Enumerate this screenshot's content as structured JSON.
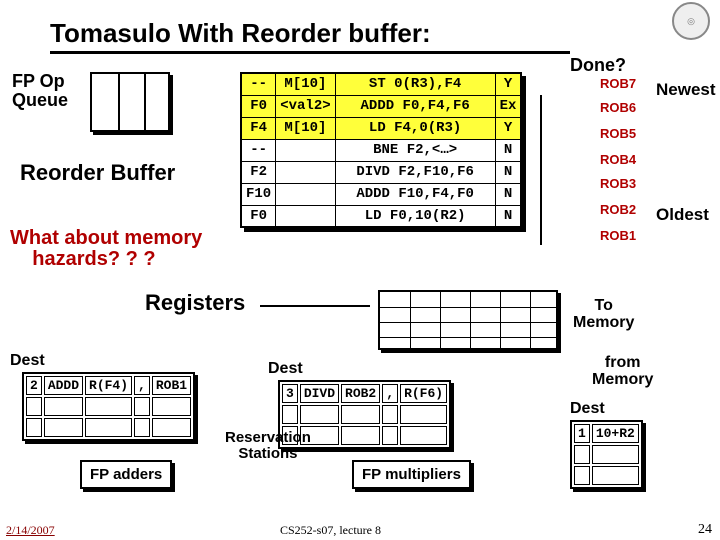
{
  "title": "Tomasulo With Reorder buffer:",
  "done_label": "Done?",
  "fp_op_queue": "FP Op\nQueue",
  "reorder_buffer_label": "Reorder Buffer",
  "what_about": "What about memory\n    hazards? ? ?",
  "registers_label": "Registers",
  "to_memory": "To\nMemory",
  "from_memory": "from\nMemory",
  "dest_label": "Dest",
  "rs_label": "Reservation\nStations",
  "fp_adders": "FP adders",
  "fp_multipliers": "FP multipliers",
  "newest": "Newest",
  "oldest": "Oldest",
  "footer_date": "2/14/2007",
  "footer_mid": "CS252-s07, lecture 8",
  "footer_num": "24",
  "rob": [
    {
      "d": "--",
      "v": "M[10]",
      "i": "ST 0(R3),F4",
      "s": "Y",
      "tag": "ROB7",
      "hl": true
    },
    {
      "d": "F0",
      "v": "<val2>",
      "i": "ADDD F0,F4,F6",
      "s": "Ex",
      "tag": "ROB6",
      "hl": true
    },
    {
      "d": "F4",
      "v": "M[10]",
      "i": "LD F4,0(R3)",
      "s": "Y",
      "tag": "ROB5",
      "hl": true
    },
    {
      "d": "--",
      "v": "",
      "i": "BNE F2,<…>",
      "s": "N",
      "tag": "ROB4",
      "hl": false
    },
    {
      "d": "F2",
      "v": "",
      "i": "DIVD F2,F10,F6",
      "s": "N",
      "tag": "ROB3",
      "hl": false
    },
    {
      "d": "F10",
      "v": "",
      "i": "ADDD F10,F4,F0",
      "s": "N",
      "tag": "ROB2",
      "hl": false
    },
    {
      "d": "F0",
      "v": "",
      "i": "LD F0,10(R2)",
      "s": "N",
      "tag": "ROB1",
      "hl": false
    }
  ],
  "rs1": {
    "n": "2",
    "op": "ADDD",
    "a": "R(F4)",
    "b": ",",
    "c": "ROB1"
  },
  "rs2": {
    "n": "3",
    "op": "DIVD",
    "a": "ROB2",
    "b": ",",
    "c": "R(F6)"
  },
  "rs3": {
    "n": "1",
    "op": "10+R2"
  }
}
